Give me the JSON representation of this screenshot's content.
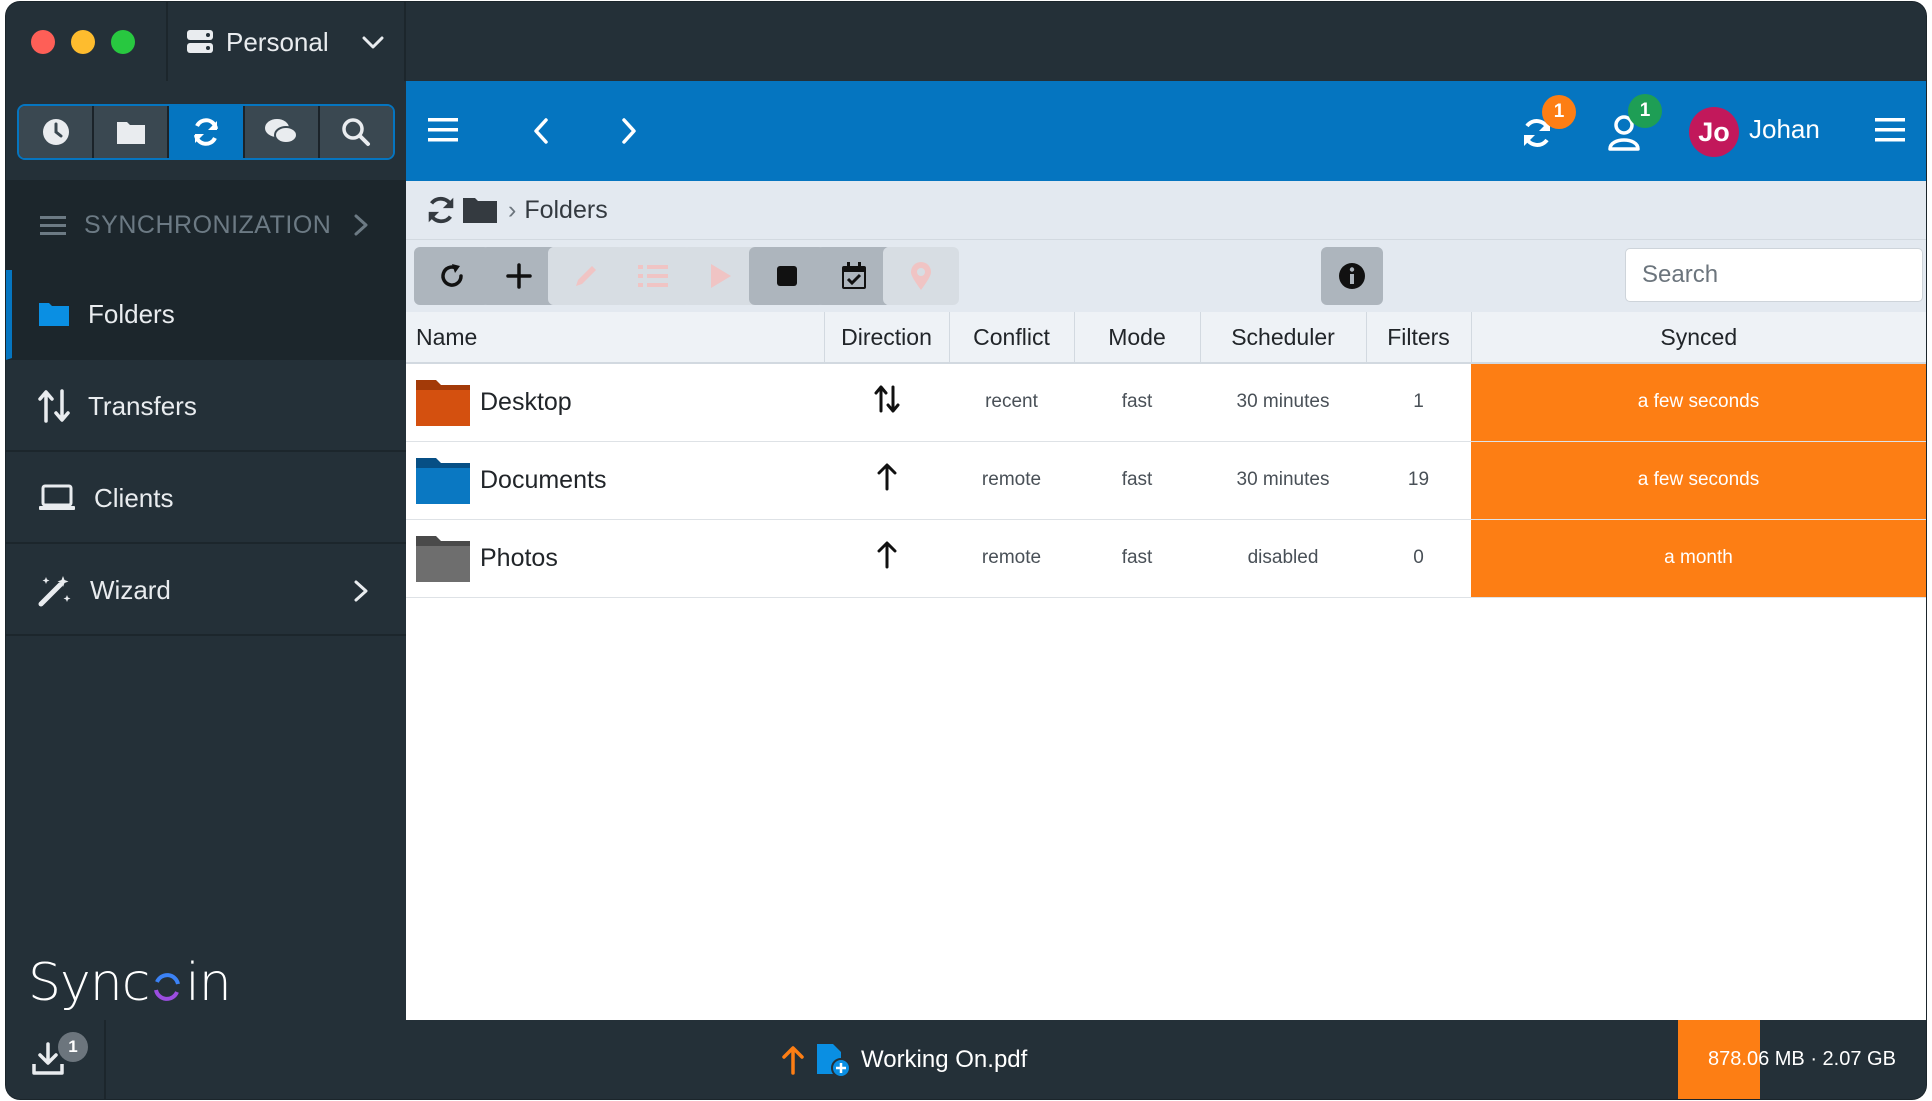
{
  "window": {
    "profile": "Personal"
  },
  "sidebar": {
    "section_title": "SYNCHRONIZATION",
    "tabs": [
      "clock-icon",
      "folder-icon",
      "sync-icon",
      "comments-icon",
      "search-icon"
    ],
    "active_tab": "sync-icon",
    "items": [
      {
        "label": "Folders",
        "icon": "folder-icon",
        "active": true
      },
      {
        "label": "Transfers",
        "icon": "transfers-icon"
      },
      {
        "label": "Clients",
        "icon": "laptop-icon"
      },
      {
        "label": "Wizard",
        "icon": "wand-icon"
      }
    ],
    "brand": {
      "text_left": "Sync",
      "text_right": "in"
    }
  },
  "topbar": {
    "sync_badge": "1",
    "users_badge": "1",
    "avatar_initials": "Jo",
    "username": "Johan",
    "colors": {
      "bar": "#0575c0",
      "sync_badge": "#fd7e14",
      "users_badge": "#1e9e55",
      "avatar": "#c2185b"
    }
  },
  "breadcrumb": {
    "current": "Folders"
  },
  "toolbar": {
    "search_placeholder": "Search",
    "buttons": [
      "refresh-icon",
      "add-icon",
      "edit-icon",
      "list-icon",
      "play-icon",
      "stop-icon",
      "calendar-check-icon",
      "marker-icon"
    ]
  },
  "table": {
    "columns": [
      "Name",
      "Direction",
      "Conflict",
      "Mode",
      "Scheduler",
      "Filters",
      "Synced"
    ],
    "rows": [
      {
        "name": "Desktop",
        "folder_color": "#d4500f",
        "direction": "both",
        "conflict": "recent",
        "mode": "fast",
        "scheduler": "30 minutes",
        "scheduler_state": "active",
        "filters": "1",
        "synced": "a few seconds"
      },
      {
        "name": "Documents",
        "folder_color": "#0a78c2",
        "direction": "up",
        "conflict": "remote",
        "mode": "fast",
        "scheduler": "30 minutes",
        "scheduler_state": "active",
        "filters": "19",
        "synced": "a few seconds"
      },
      {
        "name": "Photos",
        "folder_color": "#6e6e6e",
        "direction": "up",
        "conflict": "remote",
        "mode": "fast",
        "scheduler": "disabled",
        "scheduler_state": "disabled",
        "filters": "0",
        "synced": "a month"
      }
    ]
  },
  "statusbar": {
    "downloads_badge": "1",
    "file_name": "Working On.pdf",
    "transferred": "878.06 MB",
    "total": "2.07 GB",
    "size_text": "878.06 MB · 2.07 GB",
    "progress": 0.33
  }
}
